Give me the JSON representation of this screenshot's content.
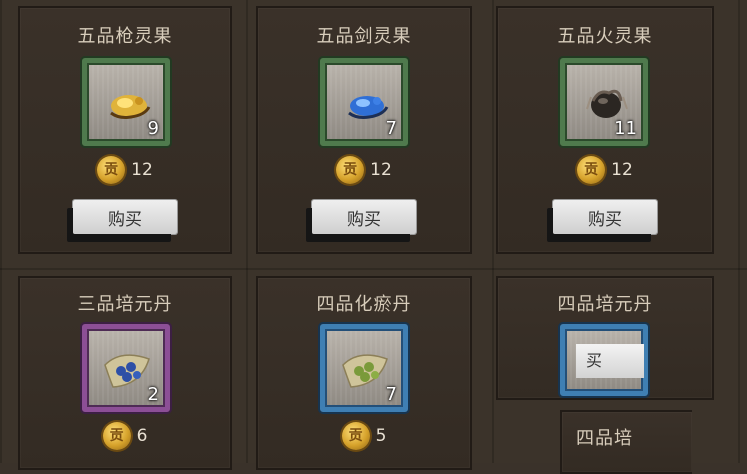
{
  "cards": [
    {
      "title": "五品枪灵果",
      "qty": "9",
      "price": "12",
      "buy": "购买",
      "coin": "贡",
      "frame": "green",
      "icon": "gold-fruit-icon"
    },
    {
      "title": "五品剑灵果",
      "qty": "7",
      "price": "12",
      "buy": "购买",
      "coin": "贡",
      "frame": "green",
      "icon": "blue-fruit-icon"
    },
    {
      "title": "五品火灵果",
      "qty": "11",
      "price": "12",
      "buy": "购买",
      "coin": "贡",
      "frame": "green",
      "icon": "fire-fruit-icon"
    },
    {
      "title": "三品培元丹",
      "qty": "2",
      "price": "6",
      "coin": "贡",
      "frame": "purple",
      "icon": "pill-leaf-icon"
    },
    {
      "title": "四品化瘀丹",
      "qty": "7",
      "price": "5",
      "coin": "贡",
      "frame": "blue",
      "icon": "pill-leaf-icon"
    },
    {
      "title": "四品培元丹",
      "frame": "blue"
    }
  ],
  "overlay": {
    "buy_fragment": "买",
    "title_fragment": "四品培"
  },
  "colors": {
    "green_frame": "#4f7a4d",
    "purple_frame": "#8c4f96",
    "blue_frame": "#3f7fb3",
    "panel": "#3b332a"
  }
}
